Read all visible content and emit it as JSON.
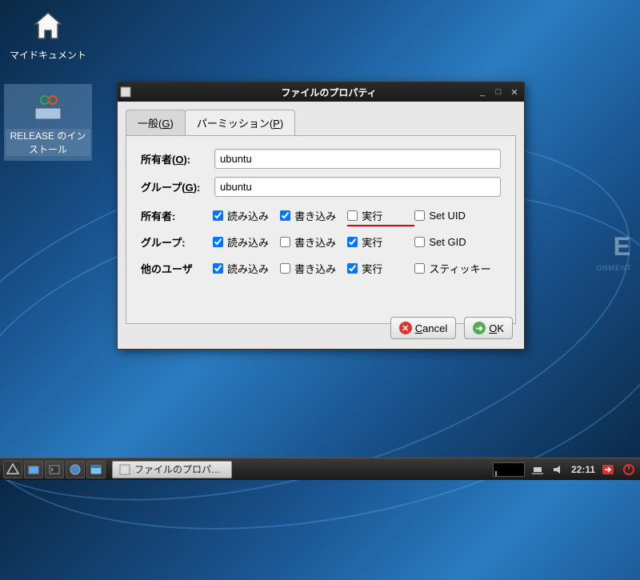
{
  "desktop": {
    "icon1_label": "マイドキュメント",
    "icon2_label": "RELEASE のインストール",
    "bg_text_large": "E",
    "bg_text_small": "ONMENT"
  },
  "dialog": {
    "title": "ファイルのプロパティ",
    "tabs": {
      "general": "一般(G)",
      "permissions": "パーミッション(P)"
    },
    "owner_label": "所有者(O):",
    "group_label": "グループ(G):",
    "owner_value": "ubuntu",
    "group_value": "ubuntu",
    "perm_rows": {
      "owner": "所有者:",
      "group": "グループ:",
      "other": "他のユーザ"
    },
    "perm_cols": {
      "read": "読み込み",
      "write": "書き込み",
      "exec": "実行",
      "setuid": "Set UID",
      "setgid": "Set GID",
      "sticky": "スティッキー"
    },
    "permissions": {
      "owner": {
        "read": true,
        "write": true,
        "exec": false,
        "special": false
      },
      "group": {
        "read": true,
        "write": false,
        "exec": true,
        "special": false
      },
      "other": {
        "read": true,
        "write": false,
        "exec": true,
        "special": false
      }
    },
    "buttons": {
      "cancel": "Cancel",
      "ok": "OK"
    }
  },
  "taskbar": {
    "task_label": "ファイルのプロパ…",
    "clock": "22:11"
  }
}
